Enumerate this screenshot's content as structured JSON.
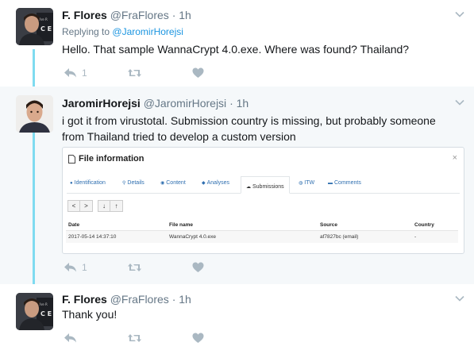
{
  "thread": {
    "tweet1": {
      "name": "F. Flores",
      "handle": "@FraFlores",
      "separator": "·",
      "time": "1h",
      "replying_prefix": "Replying to",
      "replying_mention": "@JaromirHorejsi",
      "text": "Hello. That sample WannaCrypt 4.0.exe. Where was found? Thailand?",
      "reply_count": "1"
    },
    "tweet2": {
      "name": "JaromirHorejsi",
      "handle": "@JaromirHorejsi",
      "separator": "·",
      "time": "1h",
      "text": "i got it from virustotal. Submission country is missing, but probably someone from Thailand tried to develop a custom version",
      "reply_count": "1",
      "card": {
        "title": "File information",
        "close": "×",
        "tabs": [
          "Identification",
          "Details",
          "Content",
          "Analyses",
          "Submissions",
          "ITW",
          "Comments"
        ],
        "active_tab": "Submissions",
        "pager": {
          "prev": "<",
          "next": ">",
          "down": "↓",
          "up": "↑"
        },
        "columns": [
          "Date",
          "File name",
          "Source",
          "Country"
        ],
        "rows": [
          {
            "date": "2017-05-14 14:37:10",
            "file": "WannaCrypt 4.0.exe",
            "source": "af7827bc (email)",
            "country": "-"
          }
        ]
      }
    },
    "tweet3": {
      "name": "F. Flores",
      "handle": "@FraFlores",
      "separator": "·",
      "time": "1h",
      "text": "Thank you!"
    }
  },
  "icons": {
    "reply": "reply-icon",
    "retweet": "retweet-icon",
    "like": "heart-icon",
    "caret": "chevron-down-icon"
  },
  "colors": {
    "thread_line": "#7fdbf0",
    "link": "#1b95e0",
    "muted": "#657786",
    "action": "#aab8c2",
    "highlight_bg": "#f5f8fa"
  }
}
